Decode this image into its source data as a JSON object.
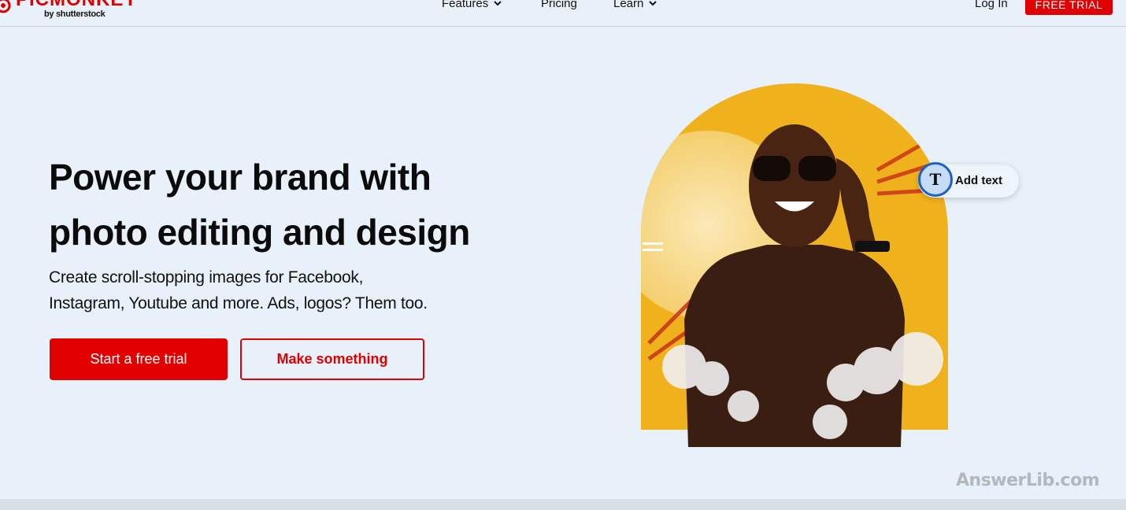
{
  "header": {
    "logo": {
      "name": "PICMONKEY",
      "sub": "by shutterstock"
    },
    "nav": [
      {
        "label": "Features",
        "has_dropdown": true
      },
      {
        "label": "Pricing",
        "has_dropdown": false
      },
      {
        "label": "Learn",
        "has_dropdown": true
      }
    ],
    "login_label": "Log In",
    "cta_label": "FREE TRIAL"
  },
  "hero": {
    "title_line1": "Power your brand with",
    "title_line2": "photo editing and design",
    "subtitle_line1": "Create scroll-stopping images for Facebook,",
    "subtitle_line2": "Instagram, Youtube and more. Ads, logos? Them too.",
    "primary_button": "Start a free trial",
    "secondary_button": "Make something",
    "image_alt": "Smiling woman wearing sunglasses against an orange sun background with clouds",
    "add_text_chip": {
      "icon_glyph": "T",
      "label": "Add text"
    }
  },
  "watermark": "AnswerLib.com",
  "colors": {
    "brand_red": "#e00000",
    "background": "#e8f1fa",
    "chip_ring": "#1d5fc9"
  }
}
